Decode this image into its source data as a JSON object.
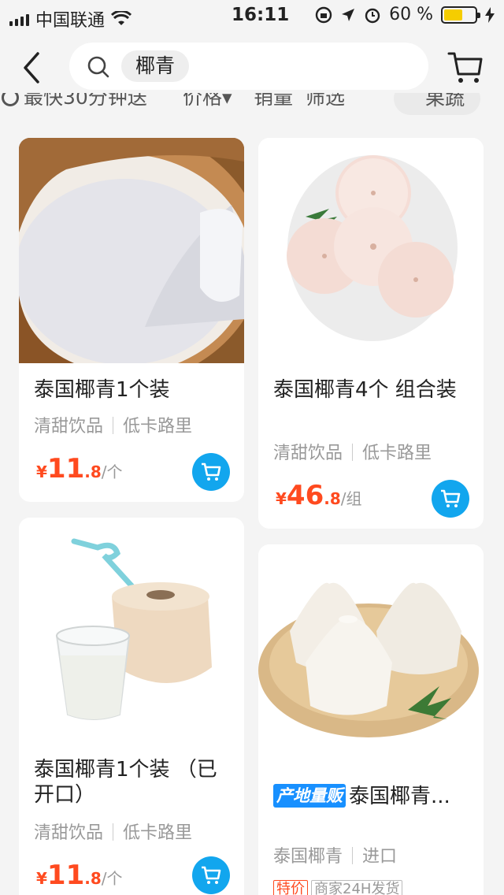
{
  "status_bar": {
    "carrier": "中国联通",
    "time": "16:11",
    "battery": "60 %",
    "battery_level": 0.6
  },
  "header": {
    "search_chip": "椰青"
  },
  "filters": {
    "items": [
      "最快30分钟送",
      "价格",
      "销量",
      "筛选"
    ],
    "chip": "果蔬"
  },
  "products": [
    {
      "title": "泰国椰青1个装",
      "tags": [
        "清甜饮品",
        "低卡路里"
      ],
      "price_symbol": "¥",
      "price_int": "11",
      "price_dec": ".8",
      "price_unit": "/个"
    },
    {
      "title": "泰国椰青4个 组合装",
      "tags": [
        "清甜饮品",
        "低卡路里"
      ],
      "price_symbol": "¥",
      "price_int": "46",
      "price_dec": ".8",
      "price_unit": "/组"
    },
    {
      "title": "泰国椰青1个装 （已开口）",
      "tags": [
        "清甜饮品",
        "低卡路里"
      ],
      "price_symbol": "¥",
      "price_int": "11",
      "price_dec": ".8",
      "price_unit": "/个"
    },
    {
      "badge": "产地量贩",
      "title": "泰国椰青...",
      "tags": [
        "泰国椰青",
        "进口"
      ],
      "promo": [
        "特价",
        "商家24H发货"
      ]
    }
  ],
  "colors": {
    "accent_blue": "#12a6ee",
    "price_red": "#ff4a1f",
    "background": "#f4f4f4"
  }
}
